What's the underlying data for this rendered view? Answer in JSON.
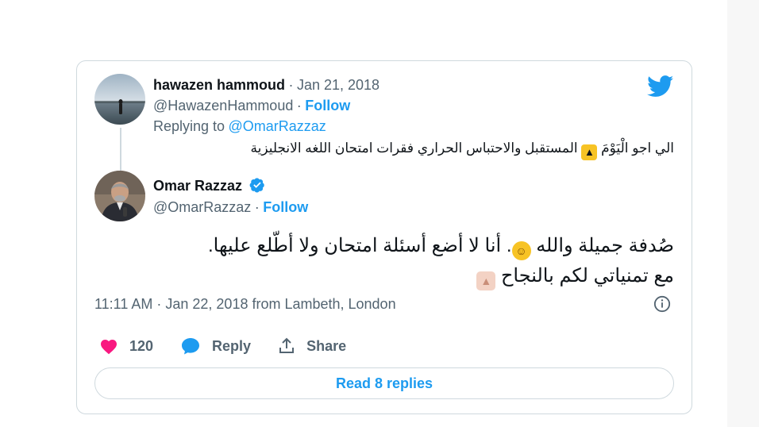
{
  "reply_tweet": {
    "author_name": "hawazen hammoud",
    "date": "Jan 21, 2018",
    "handle": "@HawazenHammoud",
    "follow_label": "Follow",
    "replying_to_prefix": "Replying to",
    "replying_to_handle": "@OmarRazzaz",
    "text_part1": "المستقبل   والاحتباس الحراري فقرات امتحان اللغه الانجليزية",
    "text_part2": "الي اجو الْيَوْمَ"
  },
  "main_tweet": {
    "author_name": "Omar Razzaz",
    "handle": "@OmarRazzaz",
    "follow_label": "Follow",
    "line1_part1": "صُدفة جميلة والله",
    "line1_part2": ". أنا لا أضع أسئلة امتحان ولا أطّلع عليها.",
    "line2": "مع تمنياتي لكم بالنجاح",
    "timestamp": "11:11 AM · Jan 22, 2018 from Lambeth, London"
  },
  "actions": {
    "likes_count": "120",
    "reply_label": "Reply",
    "share_label": "Share"
  },
  "read_replies_label": "Read 8 replies",
  "separator": "·",
  "colors": {
    "twitter_blue": "#1d9bf0",
    "like_red": "#f91880",
    "muted_gray": "#536471",
    "border": "#cfd9de"
  },
  "icons": [
    "twitter-bird-icon",
    "verified-badge-icon",
    "info-icon",
    "heart-icon",
    "reply-bubble-icon",
    "share-icon",
    "thumbs-up-emoji-icon",
    "sweat-smile-emoji-icon"
  ]
}
